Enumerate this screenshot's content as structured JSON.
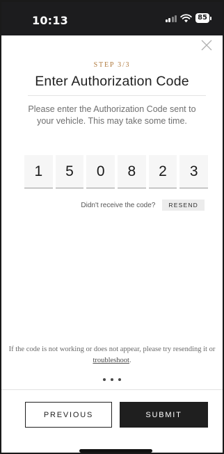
{
  "status_bar": {
    "time": "10:13",
    "battery": "85",
    "icons": [
      "signal-icon",
      "wifi-icon",
      "battery-icon"
    ]
  },
  "header": {
    "close_icon": "close-icon",
    "step": "STEP 3/3",
    "title": "Enter Authorization Code"
  },
  "instructions": "Please enter the Authorization Code sent to your vehicle. This may take some time.",
  "code": {
    "digits": [
      "1",
      "5",
      "0",
      "8",
      "2",
      "3"
    ]
  },
  "resend": {
    "prompt": "Didn't receive the code?",
    "button_label": "RESEND"
  },
  "help": {
    "text_before": "If the code is not working or does not appear, please try resending it or ",
    "link_text": "troubleshoot",
    "text_after": "."
  },
  "footer": {
    "previous_label": "PREVIOUS",
    "submit_label": "SUBMIT"
  },
  "colors": {
    "status_bar_bg": "#1c1c1e",
    "accent": "#b07a3e",
    "primary_button": "#1f1f1f"
  }
}
